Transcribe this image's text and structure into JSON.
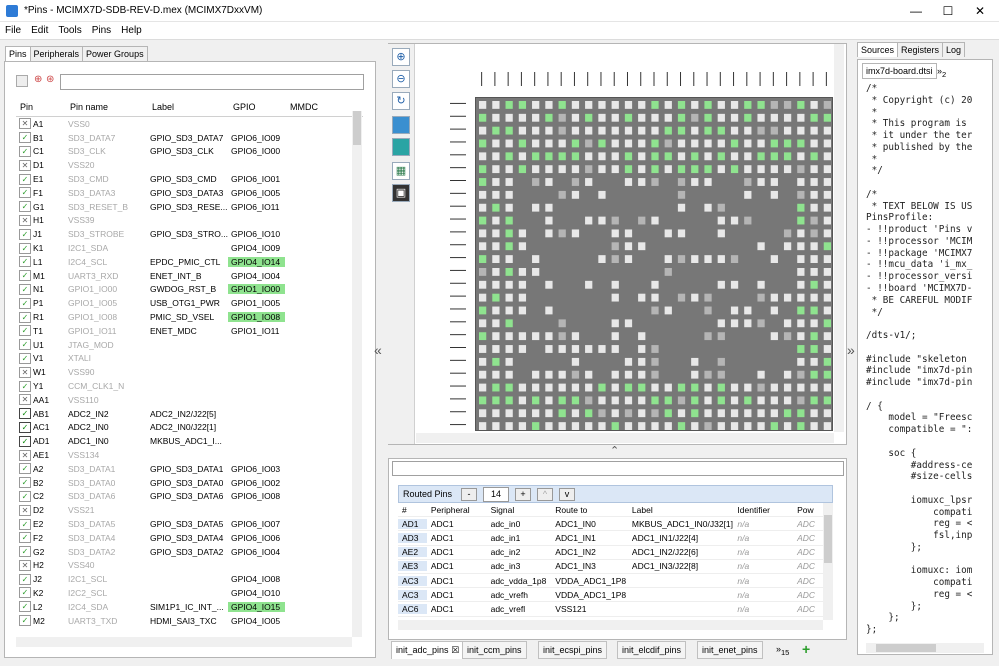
{
  "window": {
    "title": "*Pins - MCIMX7D-SDB-REV-D.mex (MCIMX7DxxVM)",
    "min": "—",
    "max": "☐",
    "close": "✕"
  },
  "menu": [
    "File",
    "Edit",
    "Tools",
    "Pins",
    "Help"
  ],
  "left_tabs": [
    "Pins",
    "Peripherals",
    "Power Groups"
  ],
  "pins": {
    "columns": [
      "Pin",
      "Pin name",
      "Label",
      "GPIO",
      "MMDC"
    ],
    "rows": [
      {
        "state": "x",
        "pin": "A1",
        "name": "VSS0",
        "dim": true,
        "label": "",
        "gpio": "",
        "hl": false
      },
      {
        "state": "c",
        "pin": "B1",
        "name": "SD3_DATA7",
        "dim": true,
        "label": "GPIO_SD3_DATA7",
        "gpio": "GPIO6_IO09",
        "hl": false
      },
      {
        "state": "c",
        "pin": "C1",
        "name": "SD3_CLK",
        "dim": true,
        "label": "GPIO_SD3_CLK",
        "gpio": "GPIO6_IO00",
        "hl": false
      },
      {
        "state": "x",
        "pin": "D1",
        "name": "VSS20",
        "dim": true,
        "label": "",
        "gpio": "",
        "hl": false
      },
      {
        "state": "c",
        "pin": "E1",
        "name": "SD3_CMD",
        "dim": true,
        "label": "GPIO_SD3_CMD",
        "gpio": "GPIO6_IO01",
        "hl": false
      },
      {
        "state": "c",
        "pin": "F1",
        "name": "SD3_DATA3",
        "dim": true,
        "label": "GPIO_SD3_DATA3",
        "gpio": "GPIO6_IO05",
        "hl": false
      },
      {
        "state": "c",
        "pin": "G1",
        "name": "SD3_RESET_B",
        "dim": true,
        "label": "GPIO_SD3_RESE...",
        "gpio": "GPIO6_IO11",
        "hl": false
      },
      {
        "state": "x",
        "pin": "H1",
        "name": "VSS39",
        "dim": true,
        "label": "",
        "gpio": "",
        "hl": false
      },
      {
        "state": "c",
        "pin": "J1",
        "name": "SD3_STROBE",
        "dim": true,
        "label": "GPIO_SD3_STRO...",
        "gpio": "GPIO6_IO10",
        "hl": false
      },
      {
        "state": "c",
        "pin": "K1",
        "name": "I2C1_SDA",
        "dim": true,
        "label": "",
        "gpio": "GPIO4_IO09",
        "hl": false
      },
      {
        "state": "c",
        "pin": "L1",
        "name": "I2C4_SCL",
        "dim": true,
        "label": "EPDC_PMIC_CTL",
        "gpio": "GPIO4_IO14",
        "hl": true
      },
      {
        "state": "c",
        "pin": "M1",
        "name": "UART3_RXD",
        "dim": true,
        "label": "ENET_INT_B",
        "gpio": "GPIO4_IO04",
        "hl": false
      },
      {
        "state": "c",
        "pin": "N1",
        "name": "GPIO1_IO00",
        "dim": true,
        "label": "GWDOG_RST_B",
        "gpio": "GPIO1_IO00",
        "hl": true
      },
      {
        "state": "c",
        "pin": "P1",
        "name": "GPIO1_IO05",
        "dim": true,
        "label": "USB_OTG1_PWR",
        "gpio": "GPIO1_IO05",
        "hl": false
      },
      {
        "state": "c",
        "pin": "R1",
        "name": "GPIO1_IO08",
        "dim": true,
        "label": "PMIC_SD_VSEL",
        "gpio": "GPIO1_IO08",
        "hl": true
      },
      {
        "state": "c",
        "pin": "T1",
        "name": "GPIO1_IO11",
        "dim": true,
        "label": "ENET_MDC",
        "gpio": "GPIO1_IO11",
        "hl": false
      },
      {
        "state": "c",
        "pin": "U1",
        "name": "JTAG_MOD",
        "dim": true,
        "label": "",
        "gpio": "",
        "hl": false
      },
      {
        "state": "c",
        "pin": "V1",
        "name": "XTALI",
        "dim": true,
        "label": "",
        "gpio": "",
        "hl": false
      },
      {
        "state": "x",
        "pin": "W1",
        "name": "VSS90",
        "dim": true,
        "label": "",
        "gpio": "",
        "hl": false
      },
      {
        "state": "c",
        "pin": "Y1",
        "name": "CCM_CLK1_N",
        "dim": true,
        "label": "",
        "gpio": "",
        "hl": false
      },
      {
        "state": "x",
        "pin": "AA1",
        "name": "VSS110",
        "dim": true,
        "label": "",
        "gpio": "",
        "hl": false
      },
      {
        "state": "s",
        "pin": "AB1",
        "name": "ADC2_IN2",
        "dim": false,
        "label": "ADC2_IN2/J22[5]",
        "gpio": "",
        "hl": false
      },
      {
        "state": "s",
        "pin": "AC1",
        "name": "ADC2_IN0",
        "dim": false,
        "label": "ADC2_IN0/J22[1]",
        "gpio": "",
        "hl": false
      },
      {
        "state": "s",
        "pin": "AD1",
        "name": "ADC1_IN0",
        "dim": false,
        "label": "MKBUS_ADC1_I...",
        "gpio": "",
        "hl": false
      },
      {
        "state": "x",
        "pin": "AE1",
        "name": "VSS134",
        "dim": true,
        "label": "",
        "gpio": "",
        "hl": false
      },
      {
        "state": "c",
        "pin": "A2",
        "name": "SD3_DATA1",
        "dim": true,
        "label": "GPIO_SD3_DATA1",
        "gpio": "GPIO6_IO03",
        "hl": false
      },
      {
        "state": "c",
        "pin": "B2",
        "name": "SD3_DATA0",
        "dim": true,
        "label": "GPIO_SD3_DATA0",
        "gpio": "GPIO6_IO02",
        "hl": false
      },
      {
        "state": "c",
        "pin": "C2",
        "name": "SD3_DATA6",
        "dim": true,
        "label": "GPIO_SD3_DATA6",
        "gpio": "GPIO6_IO08",
        "hl": false
      },
      {
        "state": "x",
        "pin": "D2",
        "name": "VSS21",
        "dim": true,
        "label": "",
        "gpio": "",
        "hl": false
      },
      {
        "state": "c",
        "pin": "E2",
        "name": "SD3_DATA5",
        "dim": true,
        "label": "GPIO_SD3_DATA5",
        "gpio": "GPIO6_IO07",
        "hl": false
      },
      {
        "state": "c",
        "pin": "F2",
        "name": "SD3_DATA4",
        "dim": true,
        "label": "GPIO_SD3_DATA4",
        "gpio": "GPIO6_IO06",
        "hl": false
      },
      {
        "state": "c",
        "pin": "G2",
        "name": "SD3_DATA2",
        "dim": true,
        "label": "GPIO_SD3_DATA2",
        "gpio": "GPIO6_IO04",
        "hl": false
      },
      {
        "state": "x",
        "pin": "H2",
        "name": "VSS40",
        "dim": true,
        "label": "",
        "gpio": "",
        "hl": false
      },
      {
        "state": "c",
        "pin": "J2",
        "name": "I2C1_SCL",
        "dim": true,
        "label": "",
        "gpio": "GPIO4_IO08",
        "hl": false
      },
      {
        "state": "c",
        "pin": "K2",
        "name": "I2C2_SCL",
        "dim": true,
        "label": "",
        "gpio": "GPIO4_IO10",
        "hl": false
      },
      {
        "state": "c",
        "pin": "L2",
        "name": "I2C4_SDA",
        "dim": true,
        "label": "SIM1P1_IC_INT_...",
        "gpio": "GPIO4_IO15",
        "hl": true
      },
      {
        "state": "c",
        "pin": "M2",
        "name": "UART3_TXD",
        "dim": true,
        "label": "HDMI_SAI3_TXC",
        "gpio": "GPIO4_IO05",
        "hl": false
      }
    ]
  },
  "routed": {
    "title": "Routed Pins",
    "minus": "-",
    "count": "14",
    "plus": "+",
    "up": "^",
    "down": "v",
    "columns": [
      "#",
      "Peripheral",
      "Signal",
      "Route to",
      "Label",
      "Identifier",
      "Pow"
    ],
    "rows": [
      [
        "AD1",
        "ADC1",
        "adc_in0",
        "ADC1_IN0",
        "MKBUS_ADC1_IN0/J32[1]",
        "n/a",
        "ADC"
      ],
      [
        "AD3",
        "ADC1",
        "adc_in1",
        "ADC1_IN1",
        "ADC1_IN1/J22[4]",
        "n/a",
        "ADC"
      ],
      [
        "AE2",
        "ADC1",
        "adc_in2",
        "ADC1_IN2",
        "ADC1_IN2/J22[6]",
        "n/a",
        "ADC"
      ],
      [
        "AE3",
        "ADC1",
        "adc_in3",
        "ADC1_IN3",
        "ADC1_IN3/J22[8]",
        "n/a",
        "ADC"
      ],
      [
        "AC3",
        "ADC1",
        "adc_vdda_1p8",
        "VDDA_ADC1_1P8",
        "",
        "n/a",
        "ADC"
      ],
      [
        "AC3",
        "ADC1",
        "adc_vrefh",
        "VDDA_ADC1_1P8",
        "",
        "n/a",
        "ADC"
      ],
      [
        "AC6",
        "ADC1",
        "adc_vrefl",
        "VSS121",
        "",
        "n/a",
        "ADC"
      ]
    ]
  },
  "bottom_tabs": [
    "init_adc_pins",
    "init_ccm_pins",
    "init_ecspi_pins",
    "init_elcdif_pins",
    "init_enet_pins",
    "15"
  ],
  "right_tabs": [
    "Sources",
    "Registers",
    "Log"
  ],
  "code_file_tab": "imx7d-board.dtsi",
  "code_file_more": "2",
  "code_lines": [
    "/*",
    " * Copyright (c) 20",
    " *",
    " * This program is",
    " * it under the ter",
    " * published by the",
    " *",
    " */",
    "",
    "/*",
    " * TEXT BELOW IS US",
    "PinsProfile:",
    "- !!product 'Pins v",
    "- !!processor 'MCIM",
    "- !!package 'MCIMX7",
    "- !!mcu_data 'i_mx_",
    "- !!processor_versi",
    "- !!board 'MCIMX7D-",
    " * BE CAREFUL MODIF",
    " */",
    "",
    "/dts-v1/;",
    "",
    "#include \"skeleton",
    "#include \"imx7d-pin",
    "#include \"imx7d-pin",
    "",
    "/ {",
    "    model = \"Freesc",
    "    compatible = \":",
    "",
    "    soc {",
    "        #address-ce",
    "        #size-cells",
    "",
    "        iomuxc_lpsr",
    "            compati",
    "            reg = <",
    "            fsl,inp",
    "        };",
    "",
    "        iomuxc: iom",
    "            compati",
    "            reg = <",
    "        };",
    "    };",
    "};"
  ],
  "colors": {
    "green": "#8fe38f",
    "grid": "#777777"
  }
}
